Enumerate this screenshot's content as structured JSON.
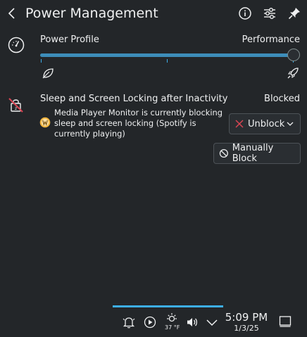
{
  "header": {
    "title": "Power Management"
  },
  "power_profile": {
    "label": "Power Profile",
    "value": "Performance",
    "level": 1.0,
    "steps": 3
  },
  "sleep": {
    "label": "Sleep and Screen Locking after Inactivity",
    "status": "Blocked",
    "inhibitor_text": "Media Player Monitor is currently blocking sleep and screen locking (Spotify is currently playing)",
    "unblock_label": "Unblock",
    "manual_block_label": "Manually Block"
  },
  "taskbar": {
    "weather_temp": "37 °F",
    "time": "5:09 PM",
    "date": "1/3/25"
  },
  "colors": {
    "background": "#232629",
    "text": "#eff0f1",
    "accent": "#3daee9",
    "danger": "#da4453",
    "inhibitor": "#f4b63f"
  },
  "icons": {
    "back": "back-arrow-icon",
    "info": "info-icon",
    "configure": "configure-icon",
    "pin": "pin-icon",
    "power_profile": "speedometer-icon",
    "eco": "leaf-icon",
    "performance": "rocket-icon",
    "sleep": "screen-lock-blocked-icon",
    "inhibitor": "media-player-monitor-icon",
    "unblock": "x-icon",
    "manual_block": "block-icon",
    "notifications": "bell-icon",
    "media": "play-icon",
    "weather": "weather-icon",
    "volume": "speaker-icon",
    "tray_expand": "chevron-down-icon",
    "show_desktop": "desktop-icon"
  }
}
